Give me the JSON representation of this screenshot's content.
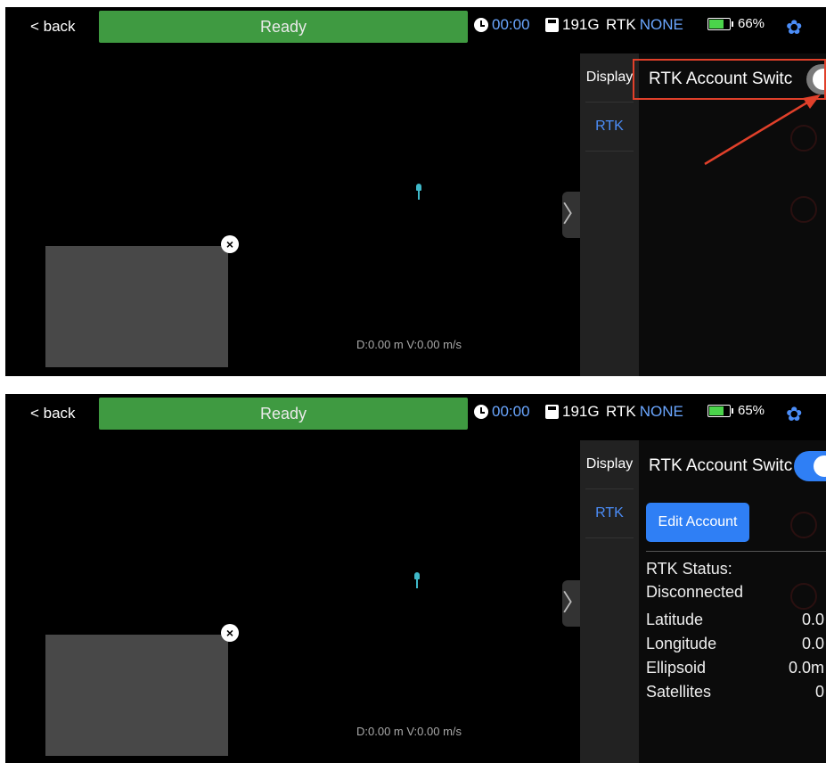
{
  "screens": [
    {
      "topbar": {
        "back_label": "< back",
        "status_label": "Ready",
        "timer": "00:00",
        "storage": "191G",
        "rtk_label": "RTK",
        "rtk_value": "NONE",
        "battery_percent": "66%",
        "battery_level": 0.66
      },
      "map": {
        "telemetry": "D:0.00 m V:0.00 m/s"
      },
      "side_panel": {
        "tabs": [
          "Display",
          "RTK"
        ],
        "rtk_switch_label": "RTK Account Switc",
        "rtk_switch_on": false
      }
    },
    {
      "topbar": {
        "back_label": "< back",
        "status_label": "Ready",
        "timer": "00:00",
        "storage": "191G",
        "rtk_label": "RTK",
        "rtk_value": "NONE",
        "battery_percent": "65%",
        "battery_level": 0.65
      },
      "map": {
        "telemetry": "D:0.00 m V:0.00 m/s"
      },
      "side_panel": {
        "tabs": [
          "Display",
          "RTK"
        ],
        "rtk_switch_label": "RTK Account Switc",
        "rtk_switch_on": true,
        "edit_account_label": "Edit Account",
        "rtk_status_label": "RTK Status:",
        "rtk_status_value": "Disconnected",
        "fields": [
          {
            "label": "Latitude",
            "value": "0.0"
          },
          {
            "label": "Longitude",
            "value": "0.0"
          },
          {
            "label": "Ellipsoid",
            "value": "0.0m"
          },
          {
            "label": "Satellites",
            "value": "0"
          }
        ]
      }
    }
  ],
  "icons": {
    "clock": "clock-icon",
    "storage": "save-disk-icon",
    "battery": "battery-icon",
    "settings": "gear-icon",
    "close": "close-icon"
  },
  "colors": {
    "status_green": "#3f9a41",
    "accent_blue": "#2f7ff5",
    "highlight_red": "#e0402a"
  }
}
